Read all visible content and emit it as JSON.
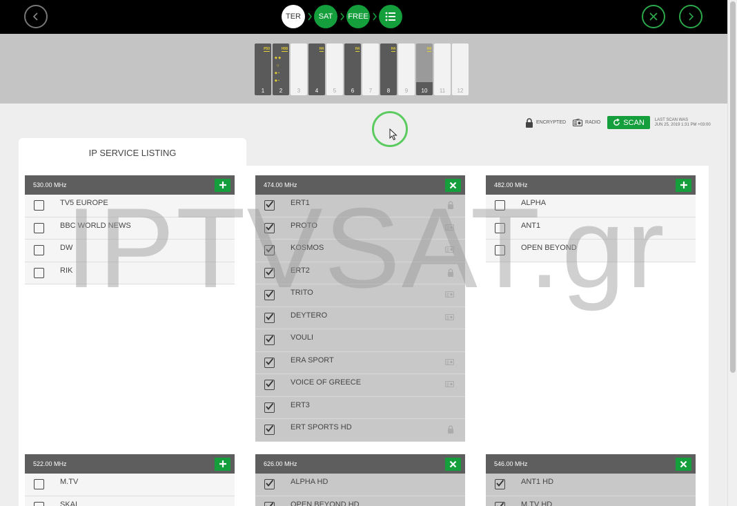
{
  "steps": [
    "TER",
    "SAT",
    "FREE"
  ],
  "tuners": [
    {
      "num": "1",
      "state": "used",
      "tag": "P50"
    },
    {
      "num": "2",
      "state": "used",
      "tag": "H08"
    },
    {
      "num": "3",
      "state": "free",
      "tag": ""
    },
    {
      "num": "4",
      "state": "used",
      "tag": "H4"
    },
    {
      "num": "5",
      "state": "free",
      "tag": ""
    },
    {
      "num": "6",
      "state": "used",
      "tag": "H4"
    },
    {
      "num": "7",
      "state": "free",
      "tag": ""
    },
    {
      "num": "8",
      "state": "used",
      "tag": "H4"
    },
    {
      "num": "9",
      "state": "free",
      "tag": ""
    },
    {
      "num": "10",
      "state": "partial",
      "tag": "H4"
    },
    {
      "num": "11",
      "state": "free",
      "tag": ""
    },
    {
      "num": "12",
      "state": "free",
      "tag": ""
    }
  ],
  "legend": {
    "encrypted": "ENCRYPTED",
    "radio": "RADIO",
    "scan": "SCAN",
    "last_scan_line1": "LAST SCAN WAS",
    "last_scan_line2": "JUN 25, 2019 1:31 PM +03:00"
  },
  "tab_label": "IP SERVICE LISTING",
  "watermark": "IPTVSAT.gr",
  "blocks": [
    {
      "freq": "530.00 MHz",
      "action": "add",
      "channels": [
        {
          "name": "TV5 EUROPE",
          "checked": false,
          "icon": ""
        },
        {
          "name": "BBC WORLD NEWS",
          "checked": false,
          "icon": ""
        },
        {
          "name": "DW",
          "checked": false,
          "icon": ""
        },
        {
          "name": "RIK",
          "checked": false,
          "icon": ""
        }
      ]
    },
    {
      "freq": "474.00 MHz",
      "action": "remove",
      "channels": [
        {
          "name": "ERT1",
          "checked": true,
          "icon": "lock"
        },
        {
          "name": "PROTO",
          "checked": true,
          "icon": "radio"
        },
        {
          "name": "KOSMOS",
          "checked": true,
          "icon": "radio"
        },
        {
          "name": "ERT2",
          "checked": true,
          "icon": "lock"
        },
        {
          "name": "TRITO",
          "checked": true,
          "icon": "radio"
        },
        {
          "name": "DEYTERO",
          "checked": true,
          "icon": "radio"
        },
        {
          "name": "VOULI",
          "checked": true,
          "icon": ""
        },
        {
          "name": "ERA SPORT",
          "checked": true,
          "icon": "radio"
        },
        {
          "name": "VOICE OF GREECE",
          "checked": true,
          "icon": "radio"
        },
        {
          "name": "ERT3",
          "checked": true,
          "icon": ""
        },
        {
          "name": "ERT SPORTS HD",
          "checked": true,
          "icon": "lock"
        }
      ]
    },
    {
      "freq": "482.00 MHz",
      "action": "add",
      "channels": [
        {
          "name": "ALPHA",
          "checked": false,
          "icon": ""
        },
        {
          "name": "ANT1",
          "checked": false,
          "icon": ""
        },
        {
          "name": "OPEN BEYOND",
          "checked": false,
          "icon": ""
        }
      ]
    },
    {
      "freq": "522.00 MHz",
      "action": "add",
      "channels": [
        {
          "name": "M.TV",
          "checked": false,
          "icon": ""
        },
        {
          "name": "SKAI",
          "checked": false,
          "icon": ""
        }
      ]
    },
    {
      "freq": "626.00 MHz",
      "action": "remove",
      "channels": [
        {
          "name": "ALPHA HD",
          "checked": true,
          "icon": ""
        },
        {
          "name": "OPEN BEYOND HD",
          "checked": true,
          "icon": ""
        }
      ]
    },
    {
      "freq": "546.00 MHz",
      "action": "remove",
      "channels": [
        {
          "name": "ANT1 HD",
          "checked": true,
          "icon": ""
        },
        {
          "name": "M.TV HD",
          "checked": true,
          "icon": ""
        }
      ]
    }
  ]
}
